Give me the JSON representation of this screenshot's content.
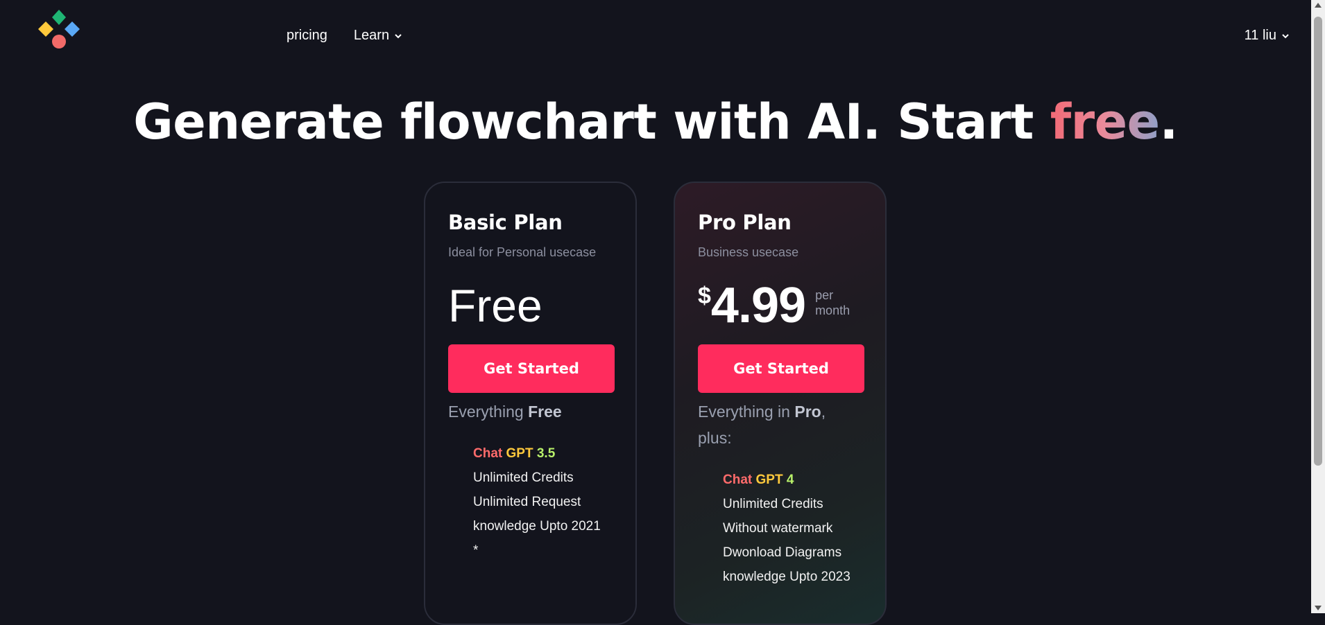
{
  "header": {
    "nav": [
      {
        "label": "pricing"
      },
      {
        "label": "Learn"
      }
    ],
    "user": {
      "label": "11 liu"
    }
  },
  "hero": {
    "title_main": "Generate flowchart with AI. Start ",
    "title_accent": "free",
    "title_end": "."
  },
  "plans": [
    {
      "name": "Basic Plan",
      "subtitle": "Ideal for Personal usecase",
      "price": "Free",
      "cta": "Get Started",
      "everything_prefix": "Everything ",
      "everything_bold": "Free",
      "everything_suffix": "",
      "gpt": {
        "chat": "Chat",
        "gpt": "GPT",
        "version": "3.5"
      },
      "features": [
        "Unlimited Credits",
        "Unlimited Request",
        "knowledge Upto 2021",
        "*"
      ]
    },
    {
      "name": "Pro Plan",
      "subtitle": "Business usecase",
      "currency": "$",
      "price": "4.99",
      "per_line1": "per",
      "per_line2": "month",
      "cta": "Get Started",
      "everything_prefix": "Everything in ",
      "everything_bold": "Pro",
      "everything_suffix": ", plus:",
      "gpt": {
        "chat": "Chat",
        "gpt": "GPT",
        "version": "4"
      },
      "features": [
        "Unlimited Credits",
        "Without watermark",
        "Dwonload Diagrams",
        "knowledge Upto 2023"
      ]
    }
  ],
  "colors": {
    "background": "#13141d",
    "cta": "#ff2c5d",
    "logo": [
      "#1fb574",
      "#ffc93c",
      "#5aa8f5",
      "#f26a68"
    ]
  },
  "icons": {
    "logo": "diamond-cluster-logo",
    "dropdown": "chevron-down-icon"
  }
}
